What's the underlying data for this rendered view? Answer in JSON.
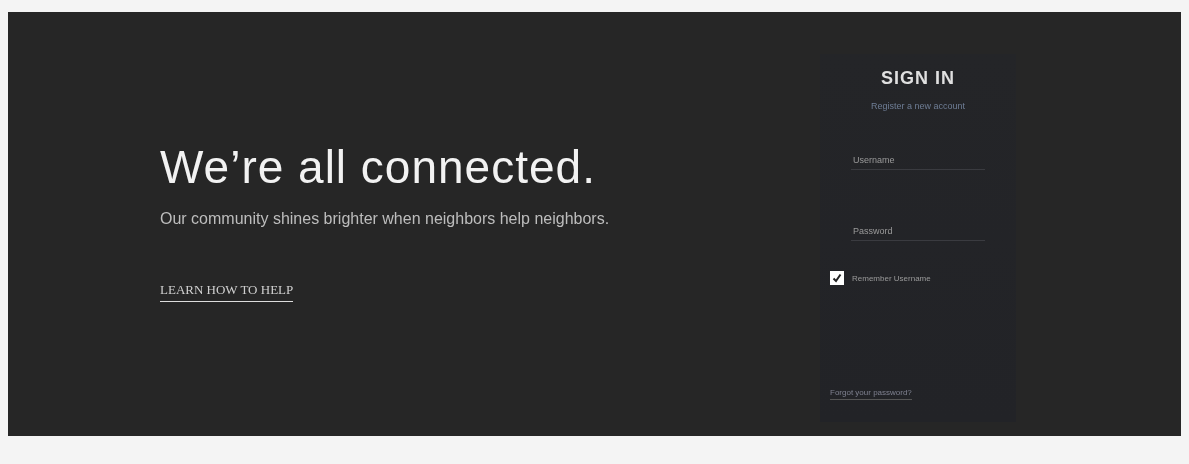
{
  "hero": {
    "headline": "We’re all connected.",
    "tagline": "Our community shines brighter when neighbors help neighbors.",
    "link": "LEARN HOW TO HELP"
  },
  "sign_in": {
    "title": "SIGN IN",
    "register_link": "Register a new account",
    "fields": [
      {
        "placeholder": "Username"
      },
      {
        "placeholder": "Password"
      }
    ],
    "remember": {
      "label": "Remember Username",
      "checked": true
    },
    "footer_link": "Forgot your password?"
  }
}
